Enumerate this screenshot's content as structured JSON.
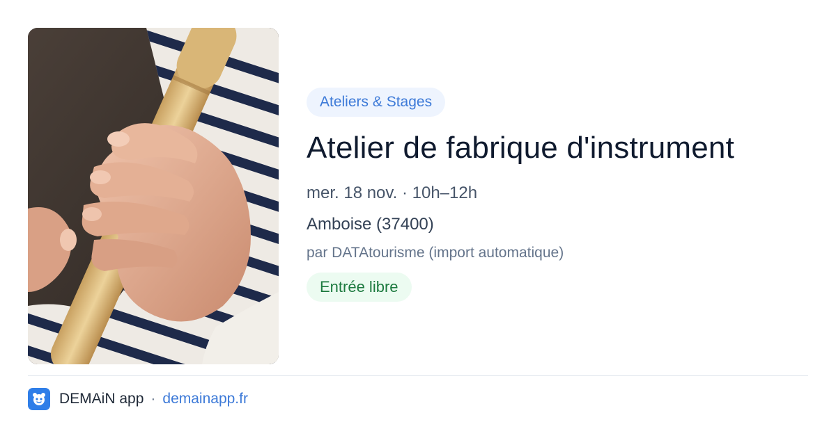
{
  "event": {
    "category": "Ateliers & Stages",
    "title": "Atelier de fabrique d'instrument",
    "datetime": "mer. 18 nov. · 10h–12h",
    "location": "Amboise (37400)",
    "organizer": "par DATAtourisme (import automatique)",
    "price": "Entrée libre",
    "image_icon": "photo-recorder-hands"
  },
  "footer": {
    "app_name": "DEMAiN app",
    "separator": "·",
    "url": "demainapp.fr",
    "app_icon": "demain-app-icon"
  },
  "colors": {
    "accent": "#3d7ad8",
    "category_bg": "#eef4fe",
    "price_text": "#1d7a3f",
    "price_bg": "#ecfbf1",
    "title": "#0f1a2e",
    "app_icon_bg": "#2f7ee8"
  }
}
